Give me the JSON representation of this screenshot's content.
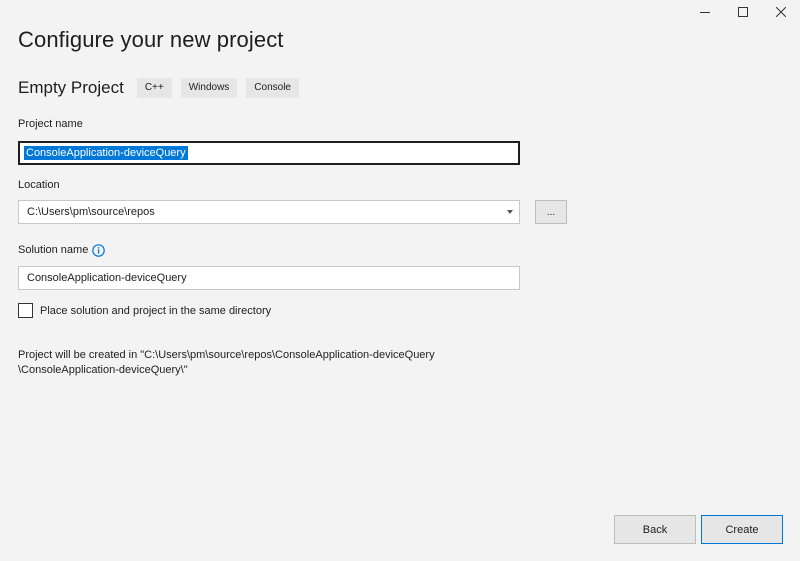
{
  "window": {
    "minimize_icon": "minimize-icon",
    "maximize_icon": "maximize-icon",
    "close_icon": "close-icon"
  },
  "page": {
    "title": "Configure your new project",
    "template_name": "Empty Project",
    "tags": [
      "C++",
      "Windows",
      "Console"
    ]
  },
  "project_name": {
    "label": "Project name",
    "value": "ConsoleApplication-deviceQuery"
  },
  "location": {
    "label": "Location",
    "value": "C:\\Users\\pm\\source\\repos",
    "browse_label": "..."
  },
  "solution_name": {
    "label": "Solution name",
    "info_icon": "info-icon",
    "value": "ConsoleApplication-deviceQuery"
  },
  "same_directory": {
    "label": "Place solution and project in the same directory",
    "checked": false
  },
  "creation_note": {
    "line1": "Project will be created in \"C:\\Users\\pm\\source\\repos\\ConsoleApplication-deviceQuery",
    "line2": "\\ConsoleApplication-deviceQuery\\\""
  },
  "footer": {
    "back_label": "Back",
    "create_label": "Create"
  },
  "colors": {
    "background": "#f3f3f3",
    "accent": "#0078d7",
    "selection": "#0078d7"
  }
}
